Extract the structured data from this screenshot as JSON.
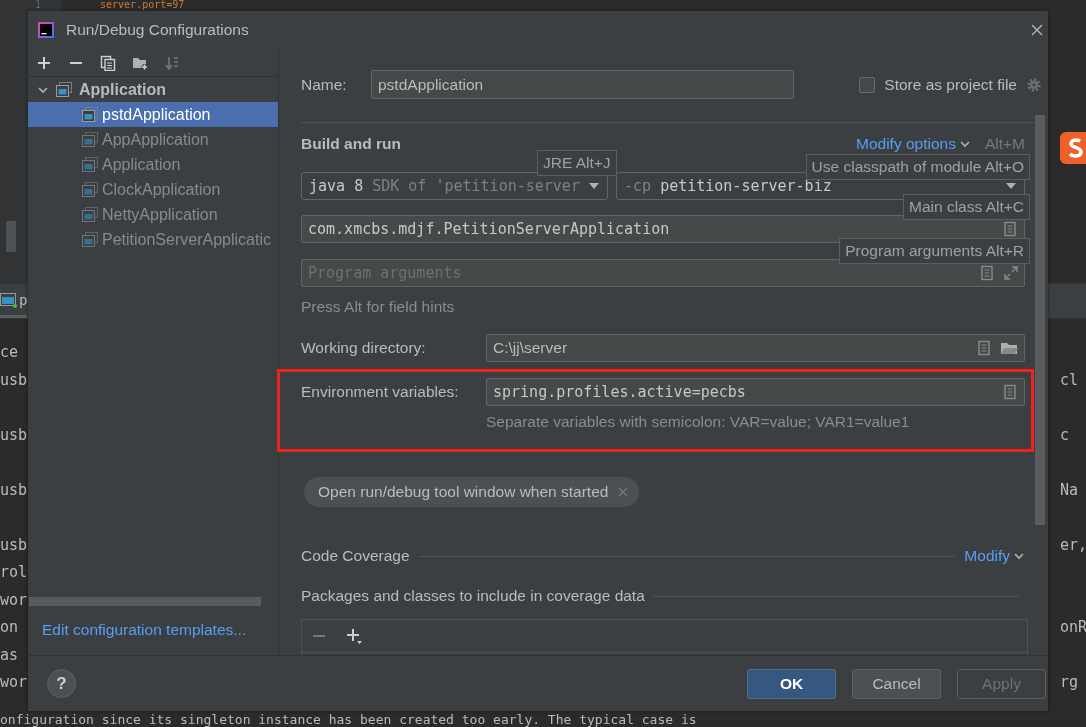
{
  "editor": {
    "line_number": "1",
    "code": "server.port=97",
    "tab_label": "p",
    "console_lines": [
      {
        "kind": "text",
        "left": "ce"
      },
      {
        "kind": "text",
        "left": "usb",
        "right": "cl"
      },
      {
        "kind": "blank"
      },
      {
        "kind": "text",
        "left": "usb",
        "right": "c"
      },
      {
        "kind": "blank"
      },
      {
        "kind": "text",
        "left": "usb",
        "right": "Na"
      },
      {
        "kind": "blank"
      },
      {
        "kind": "text",
        "left": "usb",
        "right": "er,"
      },
      {
        "kind": "text",
        "left": "rol"
      },
      {
        "kind": "text",
        "left": "wor"
      },
      {
        "kind": "text",
        "left": "on",
        "right": "onR"
      },
      {
        "kind": "text",
        "left": "as"
      },
      {
        "kind": "text",
        "left": "wor",
        "right": "rg"
      }
    ],
    "last_line": "onfiguration  since its singleton instance has been created too early. The typical case is"
  },
  "dialog": {
    "title": "Run/Debug Configurations",
    "sidebar": {
      "toolbar": [
        {
          "kind": "add",
          "disabled": false
        },
        {
          "kind": "remove",
          "disabled": false
        },
        {
          "kind": "copy",
          "disabled": false
        },
        {
          "kind": "new-folder",
          "disabled": false
        },
        {
          "kind": "sort",
          "disabled": true
        }
      ],
      "tree": [
        {
          "label": "Application",
          "expanded": true,
          "selected": false,
          "children": [
            {
              "label": "pstdApplication",
              "selected": true
            },
            {
              "label": "AppApplication",
              "selected": false
            },
            {
              "label": "Application",
              "selected": false
            },
            {
              "label": "ClockApplication",
              "selected": false
            },
            {
              "label": "NettyApplication",
              "selected": false
            },
            {
              "label": "PetitionServerApplicatic",
              "selected": false
            }
          ]
        }
      ],
      "link": "Edit configuration templates..."
    },
    "form": {
      "name_label": "Name:",
      "name_value": "pstdApplication",
      "store": {
        "label": "Store as project file",
        "checked": false
      },
      "section": "Build and run",
      "modify_options": {
        "label": "Modify options",
        "shortcut": "Alt+M"
      },
      "jre": {
        "value": "java 8",
        "hint": "SDK of 'petition-server"
      },
      "classpath": {
        "flag": "-cp",
        "module": "petition-server-biz"
      },
      "main_class": "com.xmcbs.mdjf.PetitionServerApplication",
      "program_args": {
        "placeholder": "Program arguments"
      },
      "field_hint": "Press Alt for field hints",
      "working_dir": {
        "label": "Working directory:",
        "value": "C:\\jj\\server"
      },
      "env": {
        "label": "Environment variables:",
        "value": "spring.profiles.active=pecbs",
        "hint": "Separate variables with semicolon: VAR=value; VAR1=value1",
        "highlighted": true
      },
      "chips": [
        {
          "label": "Open run/debug tool window when started"
        }
      ],
      "coverage": {
        "title": "Code Coverage",
        "action": "Modify"
      },
      "packages": {
        "title": "Packages and classes to include in coverage data",
        "remove_disabled": true,
        "add_disabled": false
      }
    },
    "tooltips": [
      {
        "text": "JRE Alt+J"
      },
      {
        "text": "Use classpath of module Alt+O"
      },
      {
        "text": "Main class Alt+C"
      },
      {
        "text": "Program arguments Alt+R"
      }
    ],
    "help": "?",
    "buttons": [
      {
        "label": "OK",
        "kind": "default",
        "disabled": false
      },
      {
        "label": "Cancel",
        "kind": "normal",
        "disabled": false
      },
      {
        "label": "Apply",
        "kind": "normal",
        "disabled": true
      }
    ]
  }
}
